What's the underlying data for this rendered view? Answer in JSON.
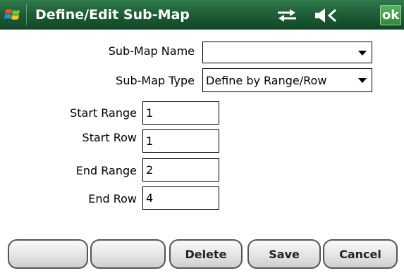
{
  "titlebar": {
    "title": "Define/Edit Sub-Map",
    "ok_label": "ok",
    "start_icon": "windows-flag-icon",
    "sync_icon": "sync-icon",
    "sound_icon": "speaker-off-icon"
  },
  "form": {
    "submap_name_label": "Sub-Map Name",
    "submap_name_value": "",
    "submap_type_label": "Sub-Map Type",
    "submap_type_value": "Define by Range/Row",
    "start_range_label": "Start Range",
    "start_range_value": "1",
    "start_row_label": "Start Row",
    "start_row_value": "1",
    "end_range_label": "End Range",
    "end_range_value": "2",
    "end_row_label": "End Row",
    "end_row_value": "4"
  },
  "buttons": {
    "blank1": "",
    "blank2": "",
    "delete": "Delete",
    "save": "Save",
    "cancel": "Cancel"
  },
  "colors": {
    "titlebar": "#1f5f37",
    "ok": "#2e8a39"
  }
}
